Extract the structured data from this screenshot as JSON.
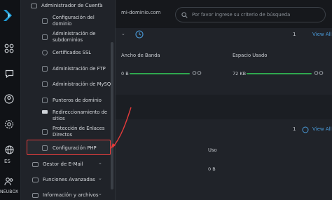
{
  "menu": {
    "section_label": "Administrador de Cuenta",
    "sub_items": [
      {
        "label": "Configuración del dominio"
      },
      {
        "label": "Administración de subdominios"
      },
      {
        "label": "Certificados SSL"
      },
      {
        "label": "Administración de FTP"
      },
      {
        "label": "Administración de MySQL"
      },
      {
        "label": "Punteros de dominio"
      },
      {
        "label": "Redireccionamiento de sitios"
      },
      {
        "label": "Protección de Enlaces Directos"
      },
      {
        "label": "Configuración PHP"
      }
    ],
    "groups": [
      {
        "label": "Gestor de E-Mail"
      },
      {
        "label": "Funciones Avanzadas"
      },
      {
        "label": "Información y archivos"
      }
    ]
  },
  "rail": {
    "language": "ES",
    "brand": "NEUBOX"
  },
  "topbar": {
    "domain": "mi-dominio.com",
    "search_placeholder": "Por favor ingrese su criterio de búsqueda"
  },
  "top_card": {
    "count": "1",
    "view_all": "View All",
    "columns": [
      "Ancho de Banda",
      "Espacio Usado"
    ],
    "values": [
      "0 B",
      "72 KB"
    ]
  },
  "bottom_card": {
    "count": "1",
    "view_all": "View All",
    "column": "Uso",
    "value": "0 B"
  },
  "colors": {
    "accent": "#2fa84f",
    "link": "#4a9ad8",
    "highlight": "#e53b3b"
  }
}
